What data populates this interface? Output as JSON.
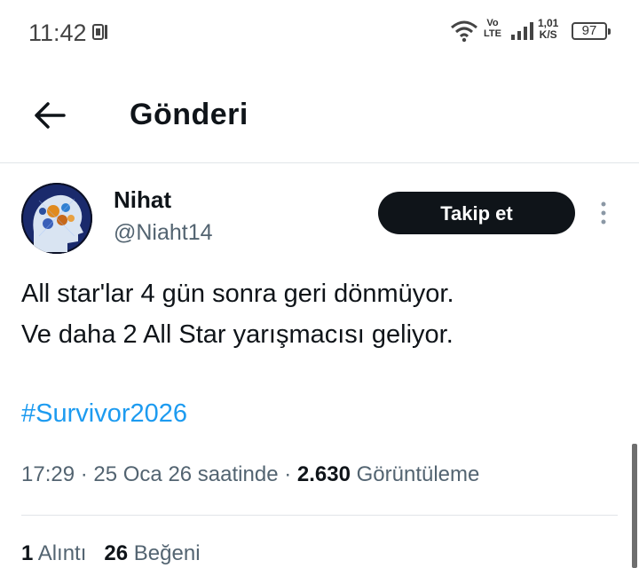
{
  "status_bar": {
    "time": "11:42",
    "volte_top": "Vo",
    "volte_bottom": "LTE",
    "speed_value": "1,01",
    "speed_unit": "K/S",
    "battery": "97"
  },
  "header": {
    "title": "Gönderi",
    "back_icon": "arrow-left-icon"
  },
  "post": {
    "display_name": "Nihat",
    "handle": "@Niaht14",
    "follow_label": "Takip et",
    "text_line1": "All star'lar 4 gün sonra geri dönmüyor.",
    "text_line2": "Ve daha 2 All Star yarışmacısı geliyor.",
    "hashtag": "#Survivor2026",
    "time": "17:29",
    "separator": " · ",
    "date": "25 Oca 26 saatinde",
    "views_count": "2.630",
    "views_label": "Görüntüleme"
  },
  "stats": {
    "quotes_count": "1",
    "quotes_label": "Alıntı",
    "likes_count": "26",
    "likes_label": "Beğeni"
  },
  "colors": {
    "accent": "#1d9bf0",
    "text": "#0f1419",
    "secondary": "#536471",
    "button_bg": "#0f1419"
  }
}
